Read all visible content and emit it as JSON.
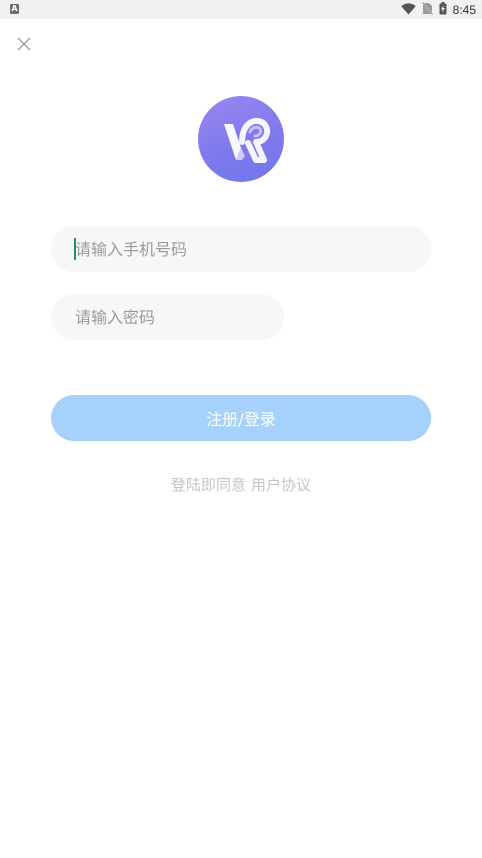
{
  "status_bar": {
    "left_icon": "A",
    "time": "8:45",
    "icons": [
      "wifi-icon",
      "no-sim-icon",
      "battery-charging-icon"
    ]
  },
  "header": {
    "close_icon": "close-icon"
  },
  "logo": {
    "icon": "vr-logo-icon",
    "colors": [
      "#9a87f2",
      "#6f78ea"
    ]
  },
  "form": {
    "phone_placeholder": "请输入手机号码",
    "phone_value": "",
    "password_placeholder": "请输入密码",
    "password_value": "",
    "submit_label": "注册/登录"
  },
  "agreement": {
    "prefix": "登陆即同意",
    "link": "用户协议"
  },
  "colors": {
    "button": "#a6d1fb",
    "input_bg": "#f7f7f7",
    "caret": "#1f8f7a"
  }
}
